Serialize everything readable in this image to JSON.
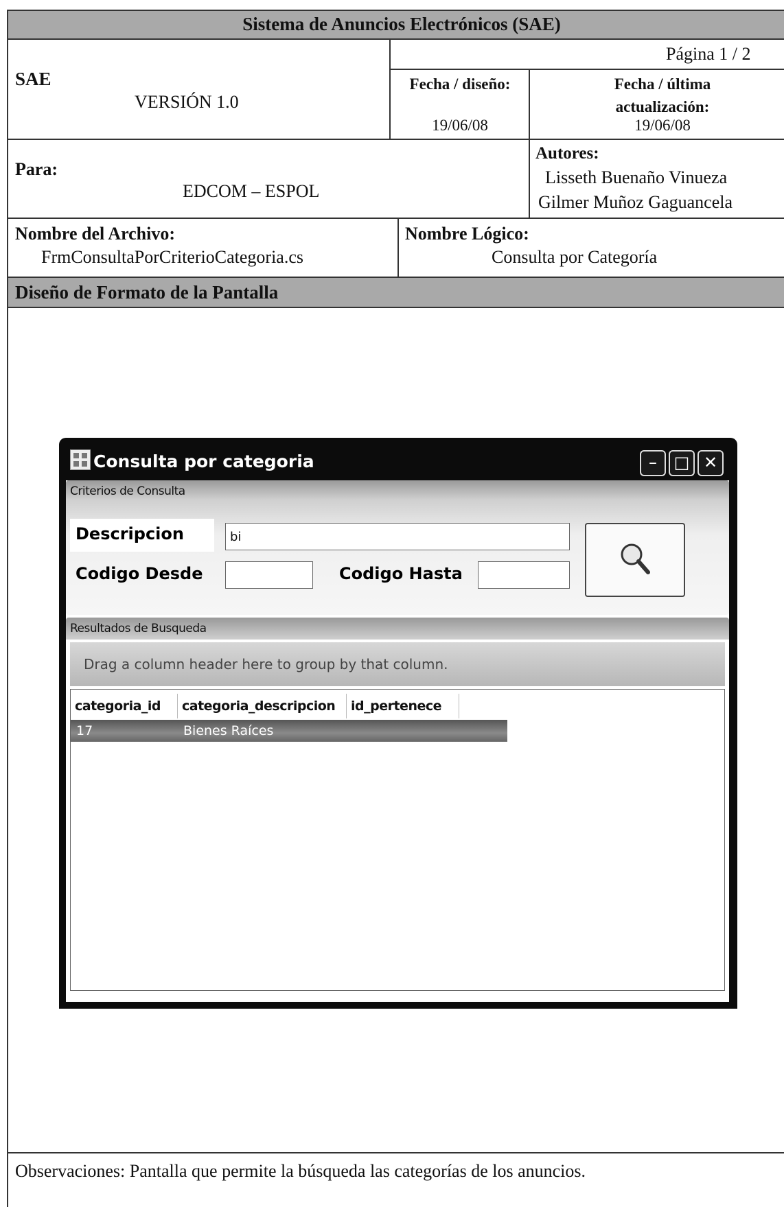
{
  "header": {
    "system_title": "Sistema de Anuncios Electrónicos (SAE)",
    "page_label": "Página  1 / 2",
    "app_code": "SAE",
    "version": "VERSIÓN 1.0",
    "design_date_label": "Fecha / diseño:",
    "design_date": "19/06/08",
    "update_date_label": "Fecha / última actualización:",
    "update_date": "19/06/08",
    "para_label": "Para:",
    "para_value": "EDCOM – ESPOL",
    "authors_label": "Autores:",
    "authors": [
      "Lisseth Buenaño Vinueza",
      "Gilmer Muñoz Gaguancela"
    ],
    "file_name_label": "Nombre del Archivo:",
    "file_name": "FrmConsultaPorCriterioCategoria.cs",
    "logical_name_label": "Nombre Lógico:",
    "logical_name": "Consulta por Categoría",
    "section_title": "Diseño de Formato de la Pantalla"
  },
  "window": {
    "title": "Consulta por categoria",
    "controls": {
      "minimize": "–",
      "maximize": "□",
      "close": "✕"
    },
    "criteria_group": "Criterios de Consulta",
    "descripcion_label": "Descripcion",
    "descripcion_value": "bi",
    "codigo_desde_label": "Codigo Desde",
    "codigo_desde_value": "",
    "codigo_hasta_label": "Codigo Hasta",
    "codigo_hasta_value": "",
    "search_icon": "magnifier-icon",
    "results_group": "Resultados de Busqueda",
    "group_panel_text": "Drag a column header here to group by that column.",
    "columns": [
      "categoria_id",
      "categoria_descripcion",
      "id_pertenece"
    ],
    "rows": [
      {
        "categoria_id": "17",
        "categoria_descripcion": "Bienes Raíces",
        "id_pertenece": ""
      }
    ]
  },
  "observations": "Observaciones: Pantalla que permite la búsqueda las categorías de los anuncios."
}
